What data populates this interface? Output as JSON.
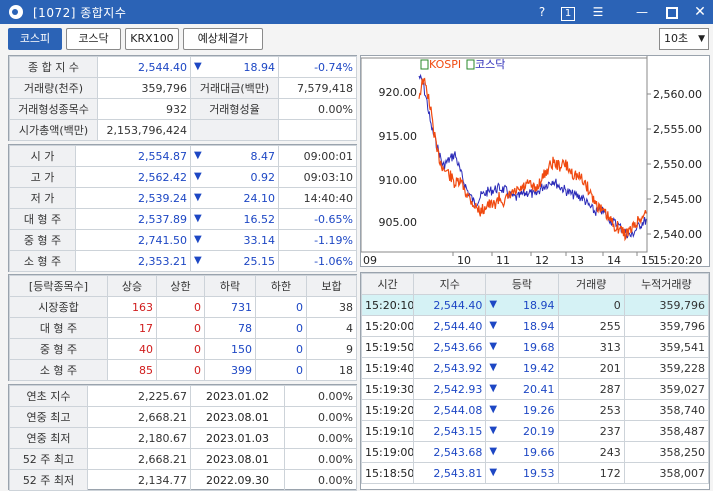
{
  "window": {
    "title": "[1072] 종합지수",
    "help": "?",
    "one": "1"
  },
  "toolbar": {
    "tabs": [
      "코스피",
      "코스닥",
      "KRX100",
      "예상체결가"
    ],
    "interval": "10초"
  },
  "summary": [
    {
      "label": "종 합 지 수",
      "value": "2,544.40",
      "arrow": "▼",
      "change": "18.94",
      "pct": "-0.74%"
    },
    {
      "label": "거래량(천주)",
      "value": "359,796",
      "label2": "거래대금(백만)",
      "value2": "7,579,418"
    },
    {
      "label": "거래형성종목수",
      "value": "932",
      "label2": "거래형성율",
      "value2": "0.00%"
    },
    {
      "label": "시가총액(백만)",
      "value": "2,153,796,424"
    }
  ],
  "prices": [
    {
      "label": "시    가",
      "value": "2,554.87",
      "arrow": "▼",
      "change": "8.47",
      "time": "09:00:01"
    },
    {
      "label": "고    가",
      "value": "2,562.42",
      "arrow": "▼",
      "change": "0.92",
      "time": "09:03:10"
    },
    {
      "label": "저    가",
      "value": "2,539.24",
      "arrow": "▼",
      "change": "24.10",
      "time": "14:40:40"
    },
    {
      "label": "대 형 주",
      "value": "2,537.89",
      "arrow": "▼",
      "change": "16.52",
      "time": "-0.65%"
    },
    {
      "label": "중 형 주",
      "value": "2,741.50",
      "arrow": "▼",
      "change": "33.14",
      "time": "-1.19%"
    },
    {
      "label": "소 형 주",
      "value": "2,353.21",
      "arrow": "▼",
      "change": "25.15",
      "time": "-1.06%"
    }
  ],
  "breadth": {
    "headers": [
      "[등락종목수]",
      "상승",
      "상한",
      "하락",
      "하한",
      "보합"
    ],
    "rows": [
      {
        "label": "시장종합",
        "up": "163",
        "upper": "0",
        "down": "731",
        "lower": "0",
        "flat": "38"
      },
      {
        "label": "대 형 주",
        "up": "17",
        "upper": "0",
        "down": "78",
        "lower": "0",
        "flat": "4"
      },
      {
        "label": "중 형 주",
        "up": "40",
        "upper": "0",
        "down": "150",
        "lower": "0",
        "flat": "9"
      },
      {
        "label": "소 형 주",
        "up": "85",
        "upper": "0",
        "down": "399",
        "lower": "0",
        "flat": "18"
      }
    ]
  },
  "yearly": [
    {
      "label": "연초  지수",
      "value": "2,225.67",
      "date": "2023.01.02",
      "pct": "0.00%"
    },
    {
      "label": "연중  최고",
      "value": "2,668.21",
      "date": "2023.08.01",
      "pct": "0.00%"
    },
    {
      "label": "연중  최저",
      "value": "2,180.67",
      "date": "2023.01.03",
      "pct": "0.00%"
    },
    {
      "label": "52 주 최고",
      "value": "2,668.21",
      "date": "2023.08.01",
      "pct": "0.00%"
    },
    {
      "label": "52 주 최저",
      "value": "2,134.77",
      "date": "2022.09.30",
      "pct": "0.00%"
    }
  ],
  "chart_data": {
    "type": "line",
    "legend": [
      "KOSPI",
      "코스닥"
    ],
    "series": [
      {
        "name": "KOSPI",
        "color": "#f04a10"
      },
      {
        "name": "코스닥",
        "color": "#2a2ab8"
      }
    ],
    "left_axis_ticks": [
      "920.00",
      "915.00",
      "910.00",
      "905.00"
    ],
    "right_axis_ticks": [
      "2,560.00",
      "2,555.00",
      "2,550.00",
      "2,545.00",
      "2,540.00"
    ],
    "x_ticks": [
      "09",
      "10",
      "11",
      "12",
      "13",
      "14",
      "15",
      "15:20:20"
    ]
  },
  "ticks": {
    "headers": [
      "시간",
      "지수",
      "등락",
      "거래량",
      "누적거래량"
    ],
    "rows": [
      {
        "time": "15:20:10",
        "index": "2,544.40",
        "arrow": "▼",
        "change": "18.94",
        "vol": "0",
        "cum": "359,796"
      },
      {
        "time": "15:20:00",
        "index": "2,544.40",
        "arrow": "▼",
        "change": "18.94",
        "vol": "255",
        "cum": "359,796"
      },
      {
        "time": "15:19:50",
        "index": "2,543.66",
        "arrow": "▼",
        "change": "19.68",
        "vol": "313",
        "cum": "359,541"
      },
      {
        "time": "15:19:40",
        "index": "2,543.92",
        "arrow": "▼",
        "change": "19.42",
        "vol": "201",
        "cum": "359,228"
      },
      {
        "time": "15:19:30",
        "index": "2,542.93",
        "arrow": "▼",
        "change": "20.41",
        "vol": "287",
        "cum": "359,027"
      },
      {
        "time": "15:19:20",
        "index": "2,544.08",
        "arrow": "▼",
        "change": "19.26",
        "vol": "253",
        "cum": "358,740"
      },
      {
        "time": "15:19:10",
        "index": "2,543.15",
        "arrow": "▼",
        "change": "20.19",
        "vol": "237",
        "cum": "358,487"
      },
      {
        "time": "15:19:00",
        "index": "2,543.68",
        "arrow": "▼",
        "change": "19.66",
        "vol": "243",
        "cum": "358,250"
      },
      {
        "time": "15:18:50",
        "index": "2,543.81",
        "arrow": "▼",
        "change": "19.53",
        "vol": "172",
        "cum": "358,007"
      }
    ]
  }
}
